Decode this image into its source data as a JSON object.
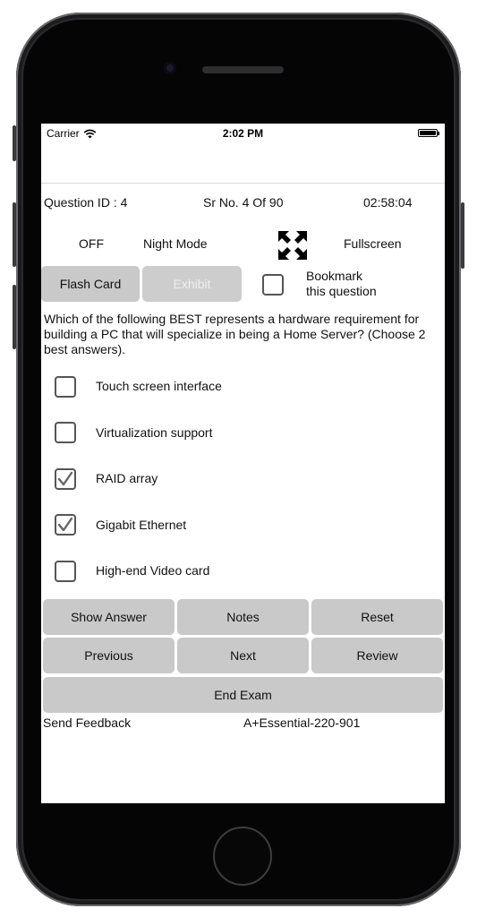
{
  "status_bar": {
    "carrier": "Carrier",
    "time": "2:02 PM"
  },
  "header": {
    "question_id": "Question ID : 4",
    "serial": "Sr No. 4 Of 90",
    "timer": "02:58:04"
  },
  "mode_row": {
    "night_mode_state": "OFF",
    "night_mode_label": "Night Mode",
    "fullscreen_label": "Fullscreen"
  },
  "toolbar": {
    "flash_card": "Flash Card",
    "exhibit": "Exhibit",
    "bookmark_line1": "Bookmark",
    "bookmark_line2": "this question",
    "bookmark_checked": false
  },
  "question": {
    "text": "Which of the following BEST represents a hardware requirement for building a PC that will specialize in being a Home Server? (Choose 2 best answers).",
    "options": [
      {
        "label": "Touch screen interface",
        "checked": false
      },
      {
        "label": "Virtualization support",
        "checked": false
      },
      {
        "label": "RAID array",
        "checked": true
      },
      {
        "label": "Gigabit Ethernet",
        "checked": true
      },
      {
        "label": "High-end Video card",
        "checked": false
      }
    ]
  },
  "actions": {
    "show_answer": "Show Answer",
    "notes": "Notes",
    "reset": "Reset",
    "previous": "Previous",
    "next": "Next",
    "review": "Review",
    "end_exam": "End Exam"
  },
  "footer": {
    "send_feedback": "Send Feedback",
    "exam_code": "A+Essential-220-901"
  },
  "colors": {
    "button_bg": "#c9c9c9",
    "disabled_text": "#eeeeee",
    "phone_frame": "#2b2b2d"
  }
}
